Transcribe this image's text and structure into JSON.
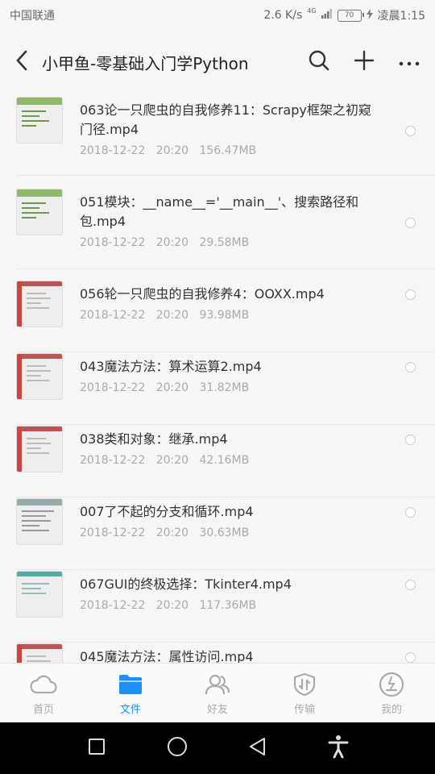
{
  "status_bar": {
    "carrier": "中国联通",
    "speed": "2.6 K/s",
    "signal": "4G",
    "battery": "70",
    "time": "凌晨1:15"
  },
  "header": {
    "title": "小甲鱼-零基础入门学Python",
    "back_icon": "chevron-left-icon",
    "search_icon": "search-icon",
    "add_icon": "plus-icon",
    "more_icon": "more-icon"
  },
  "files": [
    {
      "name": "063论一只爬虫的自我修养11：Scrapy框架之初窥门径.mp4",
      "date": "2018-12-22",
      "time": "20:20",
      "size": "156.47MB",
      "thumb": "green"
    },
    {
      "name": "051模块：__name__='__main__'、搜索路径和包.mp4",
      "date": "2018-12-22",
      "time": "20:20",
      "size": "29.58MB",
      "thumb": "green"
    },
    {
      "name": "056轮一只爬虫的自我修养4：OOXX.mp4",
      "date": "2018-12-22",
      "time": "20:20",
      "size": "93.98MB",
      "thumb": "red"
    },
    {
      "name": "043魔法方法：算术运算2.mp4",
      "date": "2018-12-22",
      "time": "20:20",
      "size": "31.82MB",
      "thumb": "red"
    },
    {
      "name": "038类和对象：继承.mp4",
      "date": "2018-12-22",
      "time": "20:20",
      "size": "42.16MB",
      "thumb": "red"
    },
    {
      "name": "007了不起的分支和循环.mp4",
      "date": "2018-12-22",
      "time": "20:20",
      "size": "30.63MB",
      "thumb": "grey"
    },
    {
      "name": "067GUI的终极选择：Tkinter4.mp4",
      "date": "2018-12-22",
      "time": "20:20",
      "size": "117.36MB",
      "thumb": "teal"
    },
    {
      "name": "045魔法方法：属性访问.mp4",
      "date": "",
      "time": "",
      "size": "",
      "thumb": "red"
    }
  ],
  "tabs": [
    {
      "label": "首页",
      "icon": "cloud-icon",
      "active": false
    },
    {
      "label": "文件",
      "icon": "folder-icon",
      "active": true
    },
    {
      "label": "好友",
      "icon": "friends-icon",
      "active": false
    },
    {
      "label": "传输",
      "icon": "transfer-icon",
      "active": false
    },
    {
      "label": "我的",
      "icon": "profile-icon",
      "active": false
    }
  ],
  "colors": {
    "accent": "#1e8ff5",
    "tab_inactive": "#aaaaaa",
    "meta_text": "#aaaaaa"
  }
}
